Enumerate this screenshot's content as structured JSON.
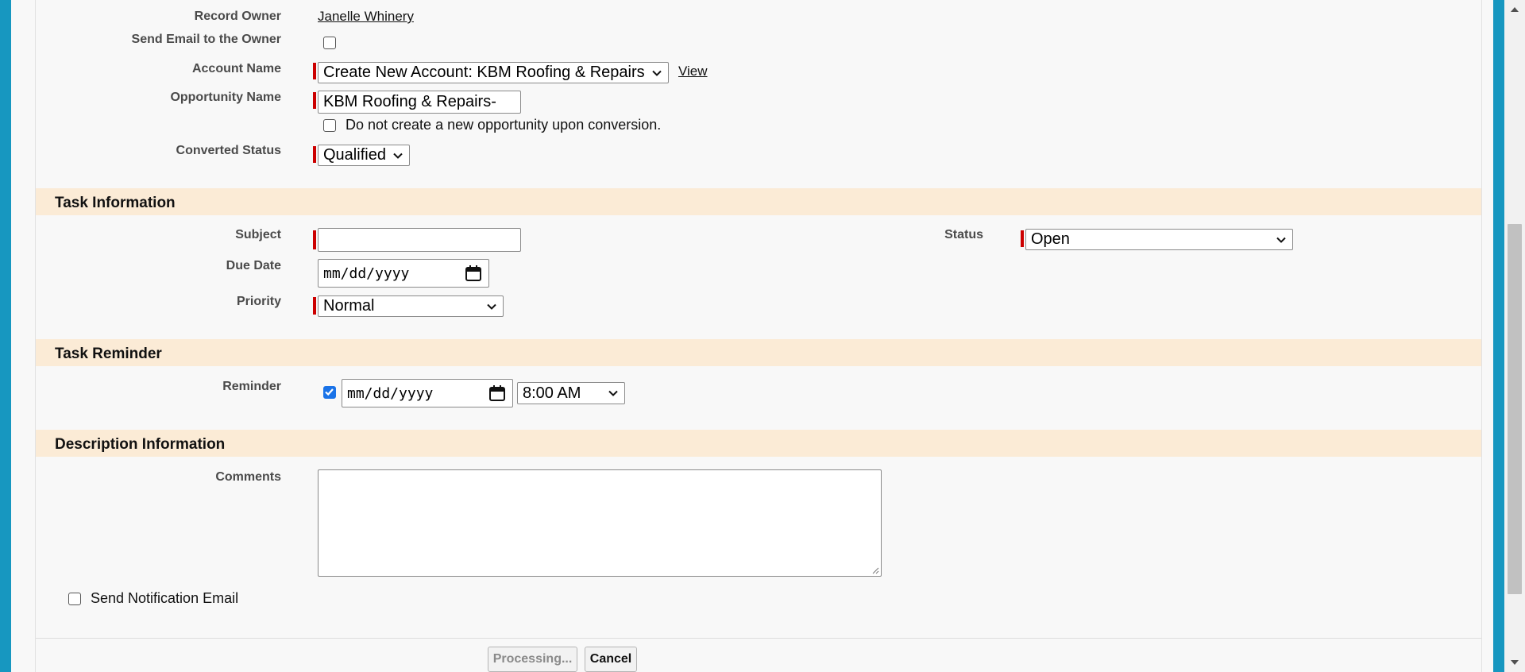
{
  "record_owner": {
    "label": "Record Owner",
    "value": "Janelle Whinery"
  },
  "send_email_owner": {
    "label": "Send Email to the Owner",
    "checked": false
  },
  "account_name": {
    "label": "Account Name",
    "value": "Create New Account: KBM Roofing & Repairs",
    "link": "View"
  },
  "opportunity_name": {
    "label": "Opportunity Name",
    "value": "KBM Roofing & Repairs-",
    "no_opp_label": "Do not create a new opportunity upon conversion.",
    "no_opp_checked": false
  },
  "converted_status": {
    "label": "Converted Status",
    "value": "Qualified"
  },
  "task_section": {
    "title": "Task Information"
  },
  "subject": {
    "label": "Subject",
    "value": ""
  },
  "status": {
    "label": "Status",
    "value": "Open"
  },
  "due_date": {
    "label": "Due Date",
    "placeholder": "mm/dd/yyyy"
  },
  "priority": {
    "label": "Priority",
    "value": "Normal"
  },
  "reminder_section": {
    "title": "Task Reminder"
  },
  "reminder": {
    "label": "Reminder",
    "checked": true,
    "date_placeholder": "mm/dd/yyyy",
    "time": "8:00 AM"
  },
  "description_section": {
    "title": "Description Information"
  },
  "comments": {
    "label": "Comments",
    "value": ""
  },
  "send_notification": {
    "label": "Send Notification Email",
    "checked": false
  },
  "buttons": {
    "processing": "Processing...",
    "cancel": "Cancel"
  },
  "colors": {
    "accent": "#1797c0",
    "required": "#cc0000",
    "section_bg": "#fbebd6",
    "checkbox_checked": "#1a73e8"
  }
}
